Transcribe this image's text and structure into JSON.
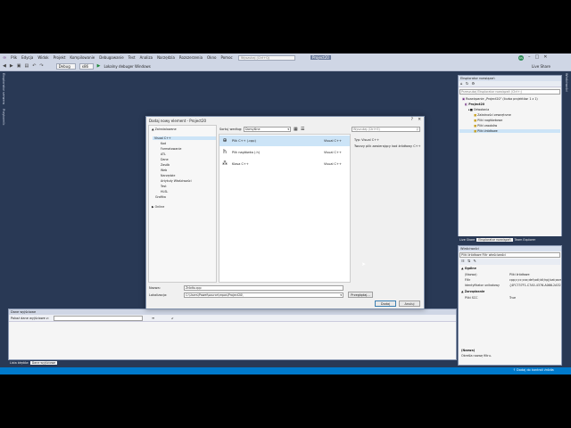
{
  "menu": [
    "Plik",
    "Edycja",
    "Widok",
    "Projekt",
    "Kompilowanie",
    "Debugowanie",
    "Test",
    "Analiza",
    "Narzędzia",
    "Rozszerzenia",
    "Okno",
    "Pomoc"
  ],
  "search_placeholder": "Wyszukaj (Ctrl+Q)",
  "project_name": "Project20",
  "avatar_initials": "KS",
  "toolbar": {
    "config": "Debug",
    "platform": "x86",
    "debugger": "Lokalny debuger Windows"
  },
  "live_share": "Live Share",
  "left_tabs": [
    "Eksplorator serwera",
    "Przybornik"
  ],
  "right_tabs": [
    "Właściwości"
  ],
  "solution_explorer": {
    "title": "Eksplorator rozwiązań",
    "search_placeholder": "Przeszukaj Eksplorator rozwiązań (Ctrl+;)",
    "items": [
      "Rozwiązanie „Project20” (liczba projektów: 1 z 1)",
      "Project20",
      "Odwołania",
      "Zależności zewnętrzne",
      "Pliki nagłówkowe",
      "Pliki zasobów",
      "Pliki źródłowe"
    ],
    "bottom_tabs": [
      "Live Share",
      "Eksplorator rozwiązań",
      "Team Explorer"
    ]
  },
  "properties": {
    "title": "Właściwości",
    "subject": "Pliki źródłowe  Filtr właściwości",
    "section_general": "Ogólne",
    "rows": [
      {
        "name": "(Nazwa)",
        "value": "Pliki źródłowe"
      },
      {
        "name": "Filtr",
        "value": "cpp;c;cc;cxx;def;odl;idl;hpj;bat;asm"
      },
      {
        "name": "Identyfikator unikatowy",
        "value": "{4FC737F1-C7A5-4376-A066-2A32}"
      }
    ],
    "section_source": "Zarządzanie",
    "rows2": [
      {
        "name": "Pliki SCC",
        "value": "True"
      }
    ],
    "desc_title": "(Nazwa)",
    "desc_text": "Określa nazwę filtru."
  },
  "dialog": {
    "title": "Dodaj nowy element - Project20",
    "installed_label": "▲ Zainstalowane",
    "categories": [
      "Visual C++",
      "Kod",
      "Formatowanie",
      "ATL",
      "Dane",
      "Zasób",
      "Web",
      "Narzędzie",
      "Artykuły Właściwości",
      "Test",
      "HLSL",
      "Grafika"
    ],
    "online_label": "▶ Online",
    "sort_label": "Sortuj według:",
    "sort_value": "Domyślne",
    "search_placeholder": "Wyszukaj (Ctrl+E)",
    "templates": [
      {
        "name": "Plik C++ (.cpp)",
        "type": "Visual C++",
        "icon": "cpp-file-icon",
        "glyph": "⊕"
      },
      {
        "name": "Plik nagłówka (.h)",
        "type": "Visual C++",
        "icon": "header-file-icon",
        "glyph": "h"
      },
      {
        "name": "Klasa C++",
        "type": "Visual C++",
        "icon": "class-icon",
        "glyph": "⁂"
      }
    ],
    "type_info": "Typ: Visual C++",
    "description": "Tworzy plik zawierający kod źródłowy C++",
    "name_label": "Nazwa:",
    "name_value": "Źródło.cpp",
    "location_label": "Lokalizacja:",
    "location_value": "C:\\Users\\Paweł\\source\\repos\\Project20\\",
    "browse_label": "Przeglądaj...",
    "add_label": "Dodaj",
    "cancel_label": "Anuluj"
  },
  "error_list": {
    "title": "Dane wyjściowe",
    "show_from": "Pokaż dane wyjściowe z:",
    "tabs": [
      "Lista błędów",
      "Dane wyjściowe"
    ]
  },
  "status": {
    "right": "Dodaj do kontroli źródła"
  }
}
